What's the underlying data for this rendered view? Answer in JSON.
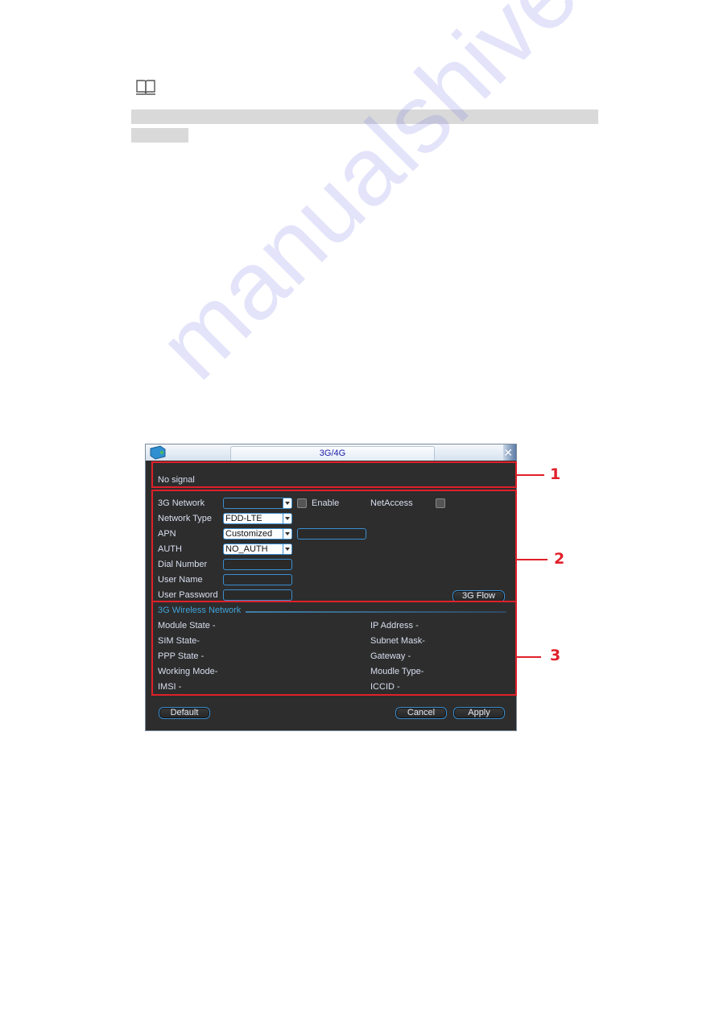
{
  "note_icon": "book-icon",
  "dialog": {
    "title": "3G/4G",
    "logo_icon": "network-globe-icon",
    "close_icon": "close-icon",
    "status": {
      "text": "No signal"
    },
    "settings": {
      "network_label": "3G Network",
      "network_value": "",
      "enable_label": "Enable",
      "netaccess_label": "NetAccess",
      "network_type_label": "Network Type",
      "network_type_value": "FDD-LTE",
      "apn_label": "APN",
      "apn_value": "Customized",
      "apn_custom_value": "",
      "auth_label": "AUTH",
      "auth_value": "NO_AUTH",
      "dial_number_label": "Dial Number",
      "dial_number_value": "",
      "user_name_label": "User Name",
      "user_name_value": "",
      "user_password_label": "User Password",
      "user_password_value": "",
      "flow_button": "3G Flow"
    },
    "wireless": {
      "section_title": "3G Wireless Network",
      "left": [
        {
          "label": "Module State",
          "value": "-"
        },
        {
          "label": "SIM State",
          "value": "-"
        },
        {
          "label": "PPP State",
          "value": "-"
        },
        {
          "label": "Working Mode",
          "value": "-"
        },
        {
          "label": "IMSI",
          "value": "-"
        }
      ],
      "right": [
        {
          "label": "IP Address",
          "value": "-"
        },
        {
          "label": "Subnet Mask",
          "value": "-"
        },
        {
          "label": "Gateway",
          "value": "-"
        },
        {
          "label": "Moudle Type",
          "value": "-"
        },
        {
          "label": "ICCID",
          "value": "-"
        }
      ]
    },
    "buttons": {
      "default": "Default",
      "cancel": "Cancel",
      "apply": "Apply"
    }
  },
  "callouts": [
    "1",
    "2",
    "3"
  ],
  "watermark": "manualshive.com",
  "colors": {
    "callout": "#e0202a",
    "dialog_bg": "#2d2d2d",
    "accent": "#3a8ed0",
    "title_text": "#1a1aa8"
  }
}
